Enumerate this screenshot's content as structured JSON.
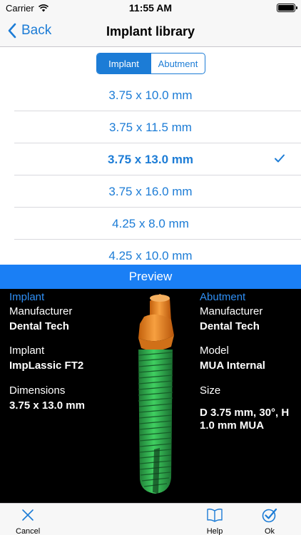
{
  "status": {
    "carrier": "Carrier",
    "time": "11:55 AM"
  },
  "nav": {
    "back_label": "Back",
    "title": "Implant library"
  },
  "segments": {
    "implant": "Implant",
    "abutment": "Abutment"
  },
  "sizes": [
    "3.75 x 10.0 mm",
    "3.75 x 11.5 mm",
    "3.75 x 13.0 mm",
    "3.75 x 16.0 mm",
    "4.25 x 8.0 mm",
    "4.25 x 10.0 mm"
  ],
  "preview": {
    "bar_label": "Preview",
    "implant": {
      "heading": "Implant",
      "manufacturer_label": "Manufacturer",
      "manufacturer": "Dental Tech",
      "implant_label": "Implant",
      "implant": "ImpLassic FT2",
      "dimensions_label": "Dimensions",
      "dimensions": "3.75 x 13.0 mm"
    },
    "abutment": {
      "heading": "Abutment",
      "manufacturer_label": "Manufacturer",
      "manufacturer": "Dental Tech",
      "model_label": "Model",
      "model": "MUA Internal",
      "size_label": "Size",
      "size_line1": "D 3.75 mm, 30°, H",
      "size_line2": "1.0 mm MUA"
    }
  },
  "toolbar": {
    "cancel": "Cancel",
    "help": "Help",
    "ok": "Ok"
  },
  "colors": {
    "accent": "#1c7cd6",
    "preview_bar": "#1a7ff5",
    "abutment": "#f28a1e",
    "implant_body": "#2bb24c"
  }
}
